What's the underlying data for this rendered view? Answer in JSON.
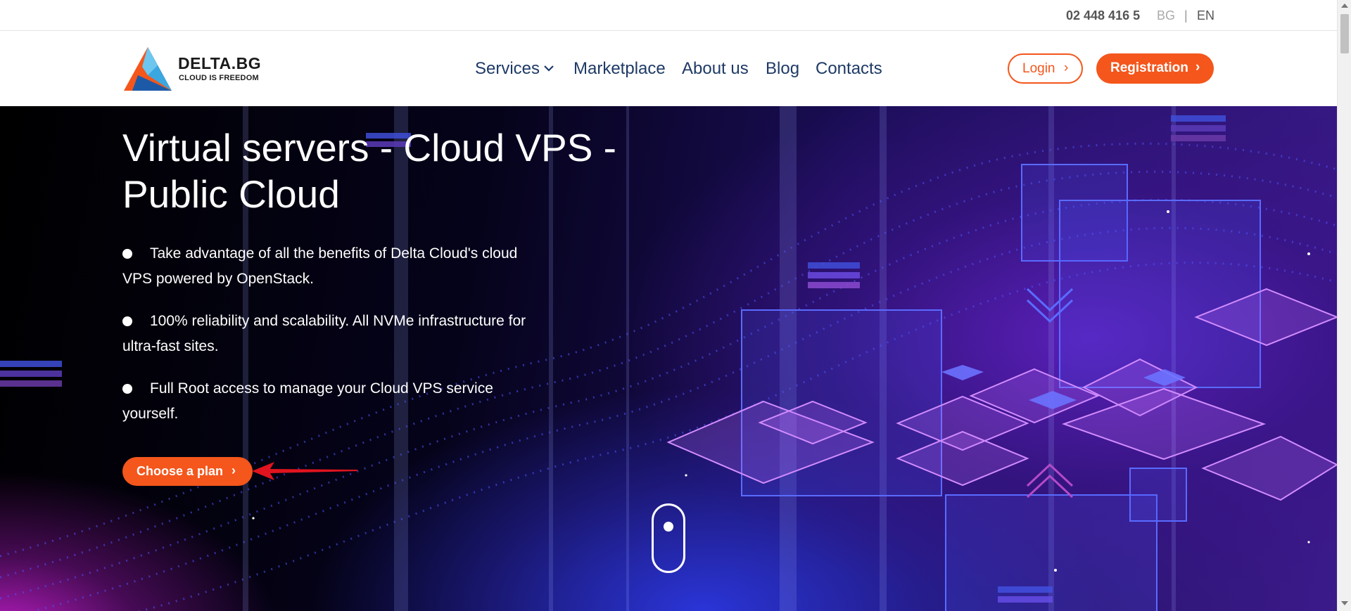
{
  "topbar": {
    "phone": "02 448 416 5",
    "lang_bg": "BG",
    "lang_separator": "|",
    "lang_en": "EN"
  },
  "header": {
    "logo_name": "DELTA.BG",
    "logo_tagline": "CLOUD IS FREEDOM",
    "nav": {
      "services": "Services",
      "marketplace": "Marketplace",
      "about": "About us",
      "blog": "Blog",
      "contacts": "Contacts"
    },
    "login_label": "Login",
    "registration_label": "Registration"
  },
  "hero": {
    "title": "Virtual servers - Cloud VPS - Public Cloud",
    "bullets": [
      "Take advantage of all the benefits of Delta Cloud's cloud VPS powered by OpenStack.",
      "100% reliability and scalability. All NVMe infrastructure for ultra-fast sites.",
      "Full Root access to manage your Cloud VPS service yourself."
    ],
    "cta_label": "Choose a plan"
  },
  "icons": {
    "chevron": "›",
    "services_dropdown": "chevron-down-icon"
  },
  "colors": {
    "accent": "#f4561c",
    "nav_text": "#1e3a66",
    "annotation_arrow": "#e0141e"
  }
}
